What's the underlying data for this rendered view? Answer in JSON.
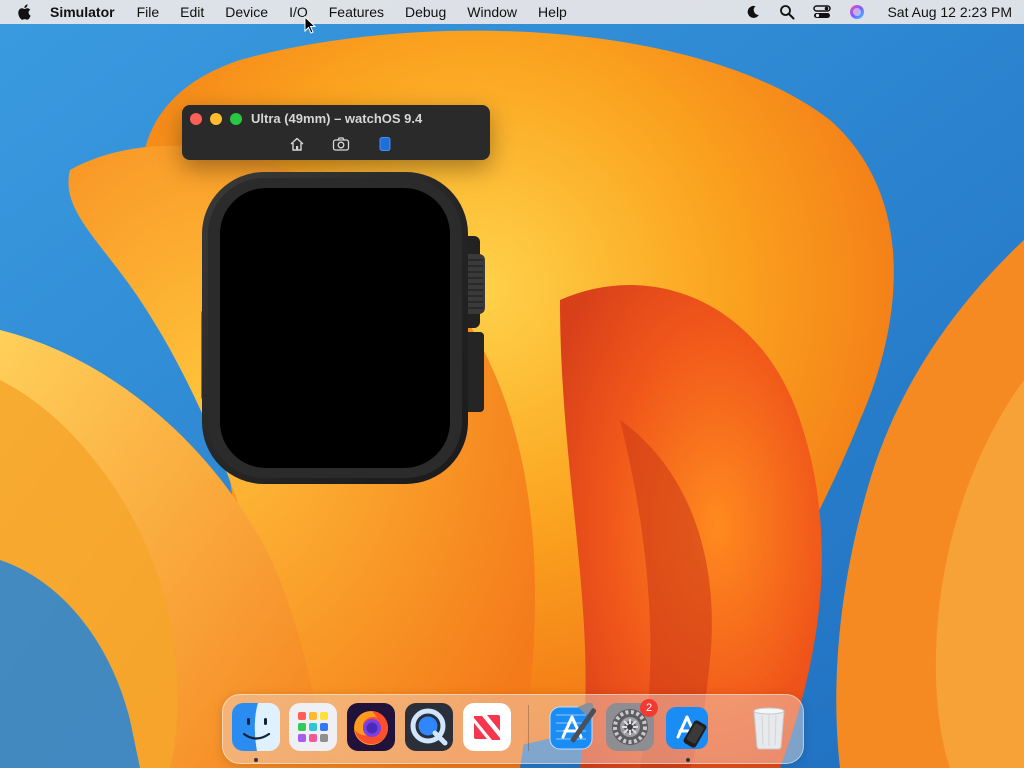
{
  "menubar": {
    "app_name": "Simulator",
    "items": [
      "File",
      "Edit",
      "Device",
      "I/O",
      "Features",
      "Debug",
      "Window",
      "Help"
    ],
    "status_icons": [
      "moon-icon",
      "search-icon",
      "control-center-icon",
      "siri-icon"
    ],
    "clock": "Sat Aug 12  2:23 PM"
  },
  "simulator": {
    "title": "Ultra (49mm) – watchOS 9.4",
    "toolbar": [
      "home-icon",
      "screenshot-icon",
      "rotate-device-icon"
    ]
  },
  "dock": {
    "apps": [
      {
        "name": "finder-icon",
        "running": true
      },
      {
        "name": "launchpad-icon",
        "running": false
      },
      {
        "name": "firefox-icon",
        "running": false
      },
      {
        "name": "quicktime-icon",
        "running": false
      },
      {
        "name": "news-icon",
        "running": false
      },
      {
        "name": "xcode-icon",
        "running": false
      },
      {
        "name": "system-settings-icon",
        "running": false,
        "badge": "2"
      },
      {
        "name": "simulator-icon",
        "running": true
      },
      {
        "name": "trash-icon",
        "running": false
      }
    ]
  },
  "colors": {
    "wallpaper_orange": "#f7941d",
    "wallpaper_blue": "#2f8fd6",
    "window_bg": "#2a2a2a",
    "accent_blue": "#1e6fd9",
    "badge_red": "#f23a33"
  }
}
